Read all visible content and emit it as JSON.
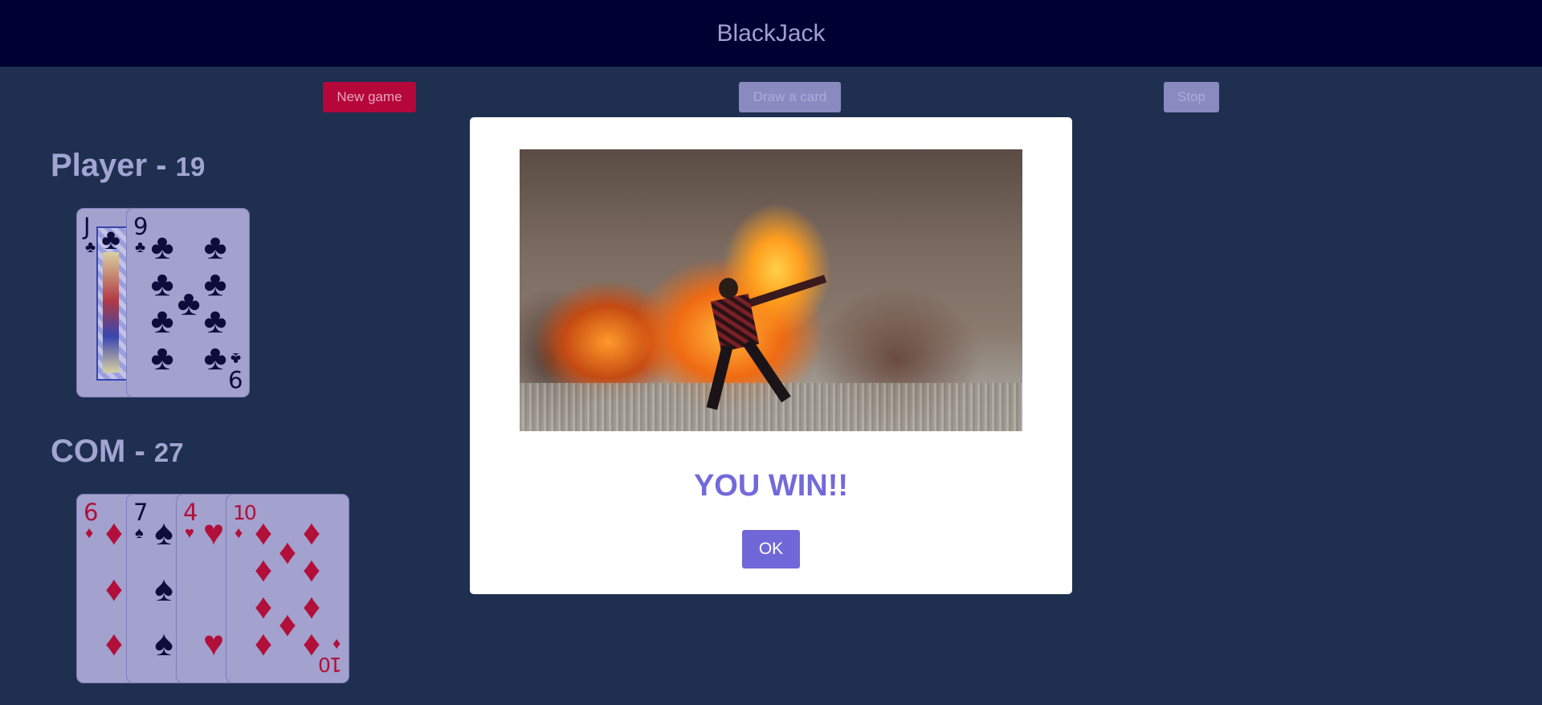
{
  "header": {
    "title": "BlackJack"
  },
  "controls": {
    "new_game": "New game",
    "draw_card": "Draw a card",
    "stop": "Stop"
  },
  "player": {
    "name": "Player",
    "separator": " - ",
    "score": "19",
    "cards": [
      {
        "rank": "J",
        "suit": "♣",
        "color": "black"
      },
      {
        "rank": "9",
        "suit": "♣",
        "color": "black"
      }
    ]
  },
  "com": {
    "name": "COM",
    "separator": " - ",
    "score": "27",
    "cards": [
      {
        "rank": "6",
        "suit": "♦",
        "color": "red"
      },
      {
        "rank": "7",
        "suit": "♠",
        "color": "black"
      },
      {
        "rank": "4",
        "suit": "♥",
        "color": "red"
      },
      {
        "rank": "10",
        "suit": "♦",
        "color": "red"
      }
    ]
  },
  "modal": {
    "message": "YOU WIN!!",
    "ok_label": "OK"
  },
  "colors": {
    "accent": "#7068d8",
    "danger": "#b5073a",
    "background": "#1e2f50",
    "header": "#000033"
  }
}
